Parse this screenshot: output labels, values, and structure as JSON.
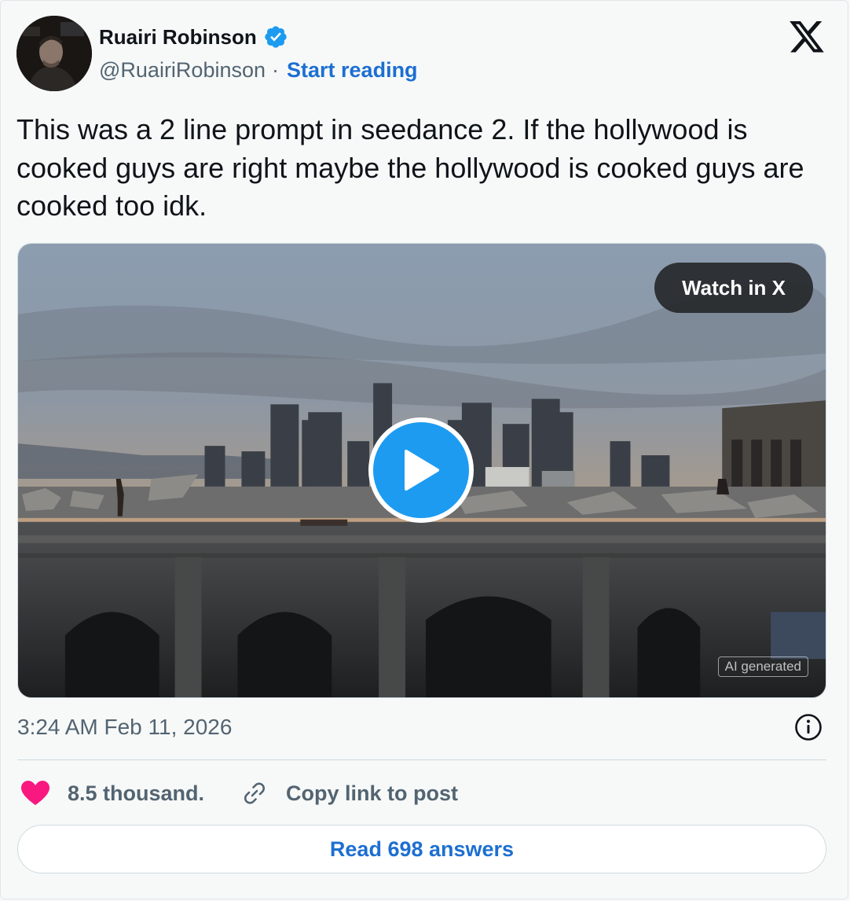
{
  "author": {
    "name": "Ruairi Robinson",
    "handle": "@RuairiRobinson",
    "separator": "·",
    "start_reading_label": "Start reading",
    "verified_icon": "verified-badge-icon"
  },
  "brand": {
    "logo": "x-logo-icon"
  },
  "tweet": {
    "text": "This was a 2 line prompt in seedance 2. If the hollywood is cooked guys are right maybe the hollywood is cooked guys are cooked too idk."
  },
  "media": {
    "watch_label": "Watch in X",
    "ai_badge": "AI generated",
    "play_icon": "play-icon"
  },
  "meta": {
    "timestamp": "3:24 AM Feb 11, 2026",
    "info_icon": "info-icon"
  },
  "actions": {
    "likes": "8.5 thousand.",
    "copy_link_label": "Copy link to post",
    "read_replies_label": "Read 698 answers"
  },
  "colors": {
    "link_blue": "#1d6fd1",
    "verified_blue": "#1d9bf0",
    "heart_pink": "#f91880",
    "muted_text": "#536471"
  }
}
